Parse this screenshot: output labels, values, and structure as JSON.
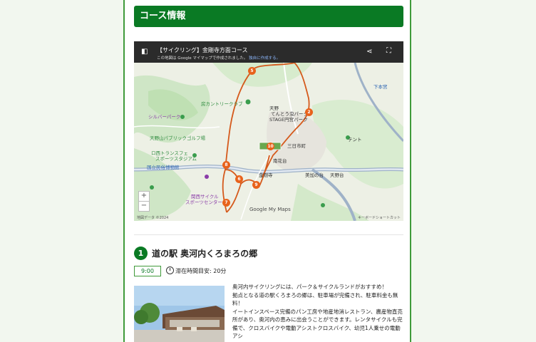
{
  "section": {
    "title": "コース情報"
  },
  "map": {
    "title": "【サイクリング】金剛寺方面コース",
    "subtitle_prefix": "この地図は Google マイマップで作成されました。",
    "subtitle_link": "独自に作成する。",
    "labels": {
      "country_club": "房カントリークラブ",
      "park": "シルバーパーク",
      "golf": "天野山パブリックゴルフ場",
      "sports": "ロ西トランスフェ",
      "sports2": "スポーツスタジアム",
      "camp": "国立民俗博物館",
      "cycle": "関西サイクル",
      "cycle2": "スポーツセンター",
      "amano": "天野",
      "park2": "てんとう虫パーク",
      "stage": "STAGE円宮パーク",
      "sennan": "三日市町",
      "minamino": "南花台",
      "kongo": "金剛寺",
      "hanasaki": "美加の台",
      "minami2": "天野台",
      "tent": "テント",
      "shimo": "下本宮"
    },
    "markers": [
      "5",
      "2",
      "10",
      "8",
      "6",
      "9",
      "7"
    ],
    "zoom_in": "+",
    "zoom_out": "−",
    "google_logo": "Google My Maps",
    "attribution": "地図データ ©2024",
    "shortcuts": "キーボードショートカット"
  },
  "step": {
    "number": "1",
    "title": "道の駅 奥河内くろまろの郷",
    "time": "9:00",
    "stay_label": "滞在時間目安: 20分",
    "description": [
      "奥河内サイクリングには、パーク＆サイクルランドがおすすめ！",
      "拠点となる道の駅くろまろの郷は、駐車場が完備され、駐車料金も無料！",
      "イートインスペース完備のパン工房や地産地消レストラン、農産物直売所があり、奥河内の恵みに出会うことができます。レンタサイクルも完備で、クロスバイクや電動アシストクロスバイク、幼児1人乗せの電動アシ"
    ]
  }
}
